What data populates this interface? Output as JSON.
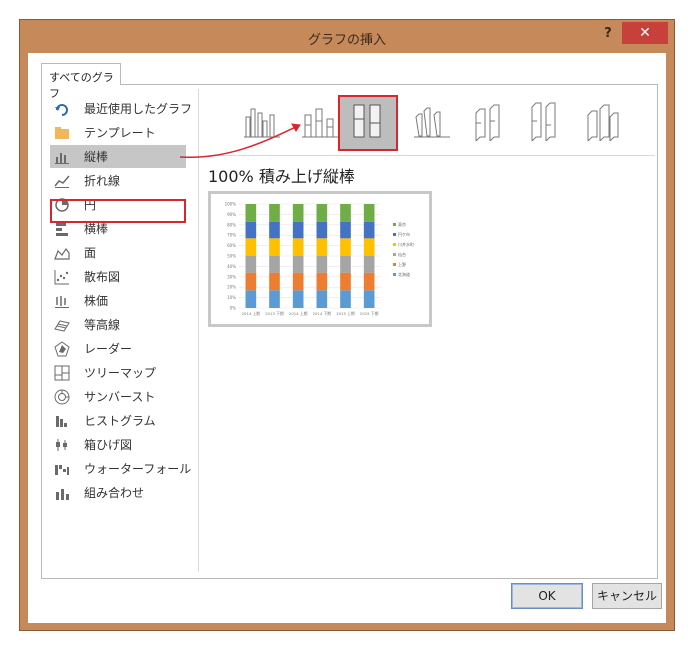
{
  "window": {
    "title": "グラフの挿入",
    "help_label": "?",
    "close_label": "✕"
  },
  "tab": {
    "label": "すべてのグラフ"
  },
  "sidebar": {
    "items": [
      {
        "label": "最近使用したグラフ",
        "icon": "recent-icon"
      },
      {
        "label": "テンプレート",
        "icon": "folder-icon"
      },
      {
        "label": "縦棒",
        "icon": "column-chart-icon",
        "selected": true
      },
      {
        "label": "折れ線",
        "icon": "line-chart-icon"
      },
      {
        "label": "円",
        "icon": "pie-chart-icon"
      },
      {
        "label": "横棒",
        "icon": "bar-chart-icon"
      },
      {
        "label": "面",
        "icon": "area-chart-icon"
      },
      {
        "label": "散布図",
        "icon": "scatter-chart-icon"
      },
      {
        "label": "株価",
        "icon": "stock-chart-icon"
      },
      {
        "label": "等高線",
        "icon": "surface-chart-icon"
      },
      {
        "label": "レーダー",
        "icon": "radar-chart-icon"
      },
      {
        "label": "ツリーマップ",
        "icon": "treemap-chart-icon"
      },
      {
        "label": "サンバースト",
        "icon": "sunburst-chart-icon"
      },
      {
        "label": "ヒストグラム",
        "icon": "histogram-chart-icon"
      },
      {
        "label": "箱ひげ図",
        "icon": "boxwhisker-chart-icon"
      },
      {
        "label": "ウォーターフォール",
        "icon": "waterfall-chart-icon"
      },
      {
        "label": "組み合わせ",
        "icon": "combo-chart-icon"
      }
    ]
  },
  "subtypes": {
    "selected_index": 2,
    "items": [
      "clustered-column-icon",
      "stacked-column-icon",
      "percent-stacked-column-icon",
      "3d-clustered-column-icon",
      "3d-stacked-column-icon",
      "3d-percent-stacked-column-icon",
      "3d-column-icon"
    ]
  },
  "chart_heading": "100% 積み上げ縦棒",
  "chart_data": {
    "type": "bar",
    "stacked": "percent",
    "categories": [
      "2014 上期",
      "2013 下期",
      "2014 上期",
      "2014 下期",
      "2015 上期",
      "2015 下期"
    ],
    "y_ticks": [
      "100%",
      "90%",
      "80%",
      "70%",
      "60%",
      "50%",
      "40%",
      "30%",
      "20%",
      "10%",
      "0%"
    ],
    "ylim": [
      0,
      100
    ],
    "legend_position": "right",
    "series": [
      {
        "name": "北海道",
        "color": "#5b9bd5",
        "values": [
          17,
          17,
          17,
          17,
          17,
          17
        ]
      },
      {
        "name": "上野",
        "color": "#ed7d31",
        "values": [
          17,
          17,
          17,
          17,
          17,
          17
        ]
      },
      {
        "name": "仙台",
        "color": "#a5a5a5",
        "values": [
          16,
          16,
          16,
          16,
          16,
          16
        ]
      },
      {
        "name": "川井水町",
        "color": "#ffc000",
        "values": [
          17,
          17,
          17,
          17,
          17,
          17
        ]
      },
      {
        "name": "円ケ市",
        "color": "#4472c4",
        "values": [
          16,
          16,
          16,
          16,
          16,
          16
        ]
      },
      {
        "name": "東京",
        "color": "#70ad47",
        "values": [
          17,
          17,
          17,
          17,
          17,
          17
        ]
      }
    ]
  },
  "buttons": {
    "ok": "OK",
    "cancel": "キャンセル"
  },
  "colors": {
    "accent_red": "#d8262c",
    "title_bar": "#c68a5a",
    "close_red": "#c7403a"
  }
}
